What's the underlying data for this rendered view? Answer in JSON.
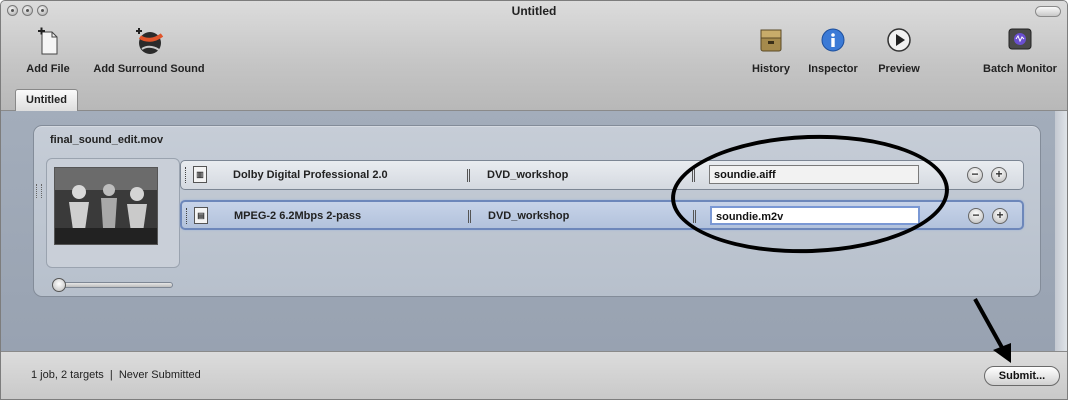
{
  "window": {
    "title": "Untitled"
  },
  "toolbar": {
    "left": [
      {
        "label": "Add File",
        "icon": "add-file-icon"
      },
      {
        "label": "Add Surround Sound",
        "icon": "surround-sound-icon"
      }
    ],
    "right": [
      {
        "label": "History",
        "icon": "history-icon"
      },
      {
        "label": "Inspector",
        "icon": "info-icon"
      },
      {
        "label": "Preview",
        "icon": "play-icon"
      },
      {
        "label": "Batch Monitor",
        "icon": "batch-monitor-icon"
      }
    ]
  },
  "tabs": [
    {
      "label": "Untitled"
    }
  ],
  "job": {
    "filename": "final_sound_edit.mov",
    "targets": [
      {
        "format": "Dolby Digital Professional 2.0",
        "destination": "DVD_workshop",
        "output": "soundie.aiff",
        "icon": "audio-file-icon",
        "selected": false
      },
      {
        "format": "MPEG-2 6.2Mbps 2-pass",
        "destination": "DVD_workshop",
        "output": "soundie.m2v",
        "icon": "video-file-icon",
        "selected": true
      }
    ]
  },
  "status": {
    "text": "1 job, 2 targets  |  Never Submitted"
  },
  "submit": {
    "label": "Submit..."
  },
  "colors": {
    "selection": "#b2c2dc",
    "panel": "#b7c0cc",
    "background": "#9ea8b6"
  }
}
